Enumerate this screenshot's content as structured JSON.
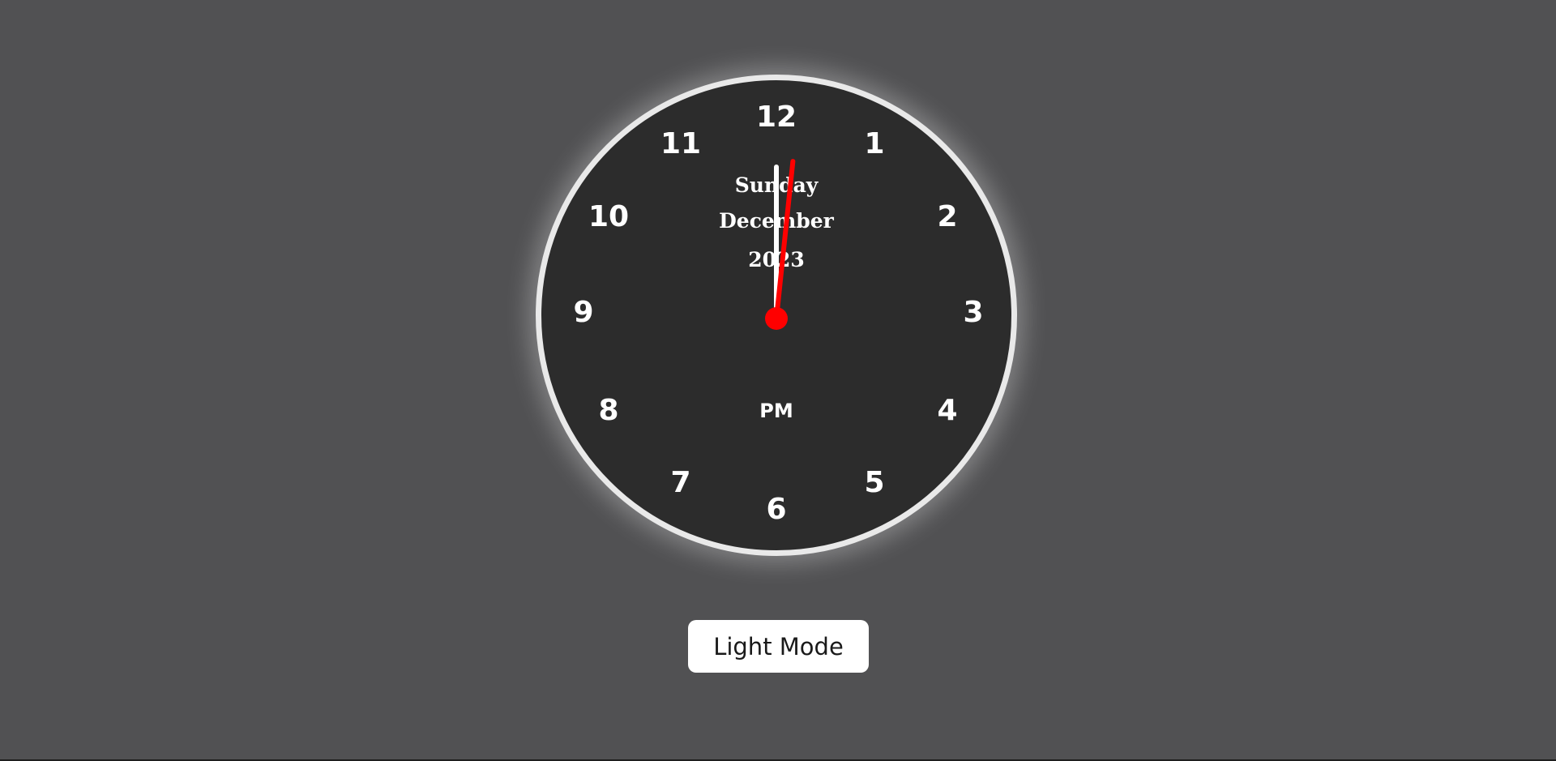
{
  "clock": {
    "numbers": [
      "12",
      "1",
      "2",
      "3",
      "4",
      "5",
      "6",
      "7",
      "8",
      "9",
      "10",
      "11"
    ],
    "day": "Sunday",
    "month": "December",
    "year": "2023",
    "period": "PM",
    "second_hand_color": "#ff0000",
    "face_color": "#2c2c2c",
    "rim_color": "#e9e9e9",
    "time_shown": {
      "hour_hand_deg": 0,
      "minute_hand_deg": 0,
      "second_hand_deg": 6
    }
  },
  "controls": {
    "mode_button_label": "Light Mode"
  },
  "page": {
    "background_color": "#515153"
  }
}
